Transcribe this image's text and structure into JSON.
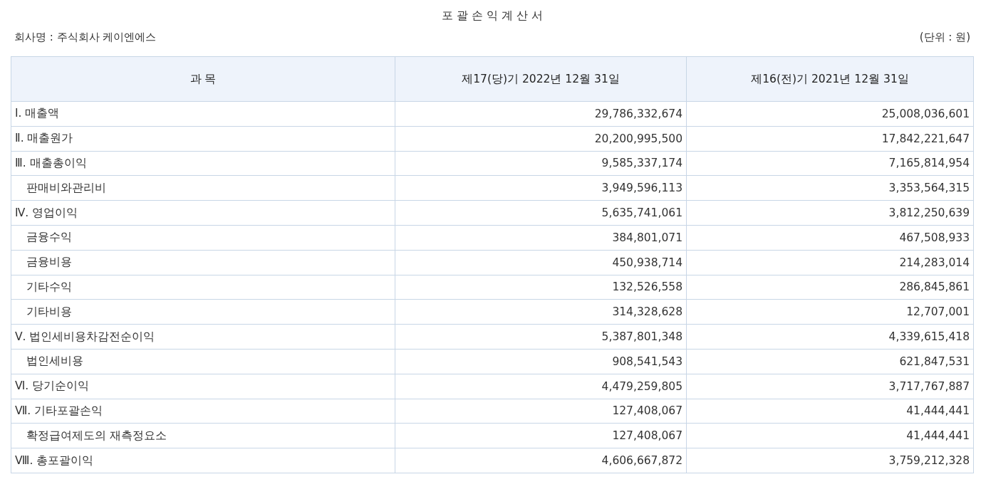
{
  "title": "포 괄 손 익 계 산 서",
  "company": "회사명 : 주식회사 케이엔에스",
  "unit": "(단위 : 원)",
  "table": {
    "columns": [
      "과 목",
      "제17(당)기 2022년 12월 31일",
      "제16(전)기 2021년 12월 31일"
    ],
    "rows": [
      {
        "label": "Ⅰ. 매출액",
        "values": [
          "29,786,332,674",
          "25,008,036,601"
        ]
      },
      {
        "label": "Ⅱ. 매출원가",
        "values": [
          "20,200,995,500",
          "17,842,221,647"
        ]
      },
      {
        "label": "Ⅲ. 매출총이익",
        "values": [
          "9,585,337,174",
          "7,165,814,954"
        ],
        "children": [
          {
            "label": "판매비와관리비",
            "values": [
              "3,949,596,113",
              "3,353,564,315"
            ]
          }
        ]
      },
      {
        "label": "Ⅳ. 영업이익",
        "values": [
          "5,635,741,061",
          "3,812,250,639"
        ],
        "children": [
          {
            "label": "금융수익",
            "values": [
              "384,801,071",
              "467,508,933"
            ]
          },
          {
            "label": "금융비용",
            "values": [
              "450,938,714",
              "214,283,014"
            ]
          },
          {
            "label": "기타수익",
            "values": [
              "132,526,558",
              "286,845,861"
            ]
          },
          {
            "label": "기타비용",
            "values": [
              "314,328,628",
              "12,707,001"
            ]
          }
        ]
      },
      {
        "label": "Ⅴ. 법인세비용차감전순이익",
        "values": [
          "5,387,801,348",
          "4,339,615,418"
        ],
        "children": [
          {
            "label": "법인세비용",
            "values": [
              "908,541,543",
              "621,847,531"
            ]
          }
        ]
      },
      {
        "label": "Ⅵ. 당기순이익",
        "values": [
          "4,479,259,805",
          "3,717,767,887"
        ]
      },
      {
        "label": "Ⅶ. 기타포괄손익",
        "values": [
          "127,408,067",
          "41,444,441"
        ],
        "children": [
          {
            "label": "확정급여제도의 재측정요소",
            "values": [
              "127,408,067",
              "41,444,441"
            ]
          }
        ]
      },
      {
        "label": "Ⅷ. 총포괄이익",
        "values": [
          "4,606,667,872",
          "3,759,212,328"
        ]
      }
    ]
  }
}
